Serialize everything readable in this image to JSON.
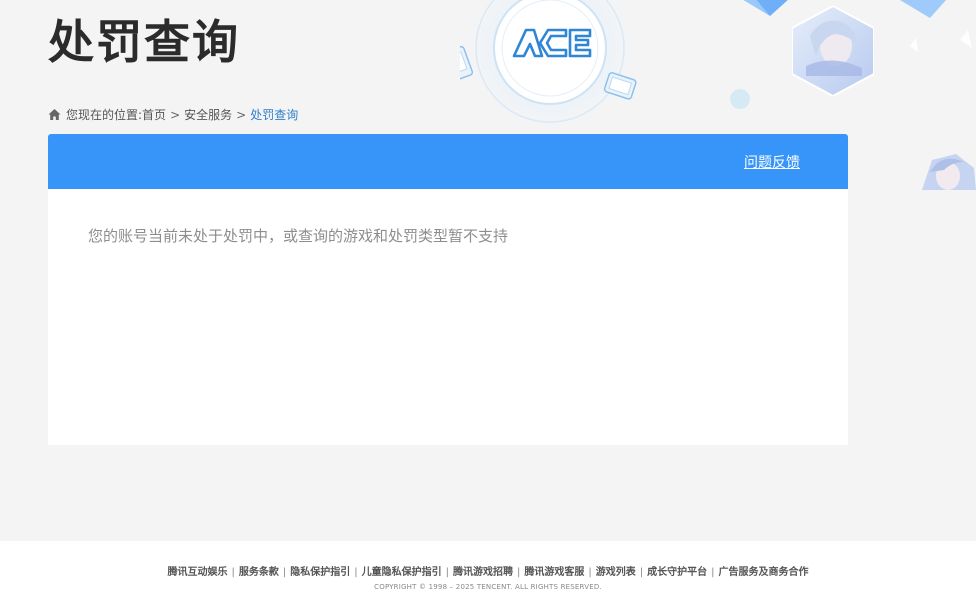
{
  "header": {
    "title": "处罚查询"
  },
  "breadcrumb": {
    "prefix": "您现在的位置:",
    "items": [
      "首页",
      "安全服务",
      "处罚查询"
    ],
    "separator": ">"
  },
  "card": {
    "feedback_label": "问题反馈",
    "message": "您的账号当前未处于处罚中，或查询的游戏和处罚类型暂不支持"
  },
  "footer": {
    "links": [
      "腾讯互动娱乐",
      "服务条款",
      "隐私保护指引",
      "儿童隐私保护指引",
      "腾讯游戏招聘",
      "腾讯游戏客服",
      "游戏列表",
      "成长守护平台",
      "广告服务及商务合作"
    ],
    "separator": "|",
    "copyright": "COPYRIGHT © 1998 – 2025 TENCENT. ALL RIGHTS RESERVED."
  },
  "decor": {
    "shield_logo_text": "ACE",
    "icon_names": [
      "home-icon",
      "ace-shield-logo",
      "phone-icon",
      "game-icon"
    ],
    "colors": {
      "accent": "#3795fa",
      "page_bg": "#f4f4f5",
      "breadcrumb_current": "#2f7fc9"
    }
  }
}
